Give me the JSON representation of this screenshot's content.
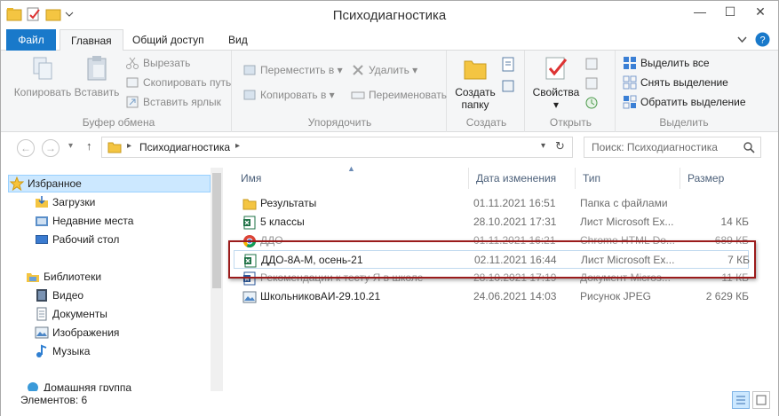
{
  "window": {
    "title": "Психодиагностика"
  },
  "tabs": [
    {
      "label": "Файл"
    },
    {
      "label": "Главная"
    },
    {
      "label": "Общий доступ"
    },
    {
      "label": "Вид"
    }
  ],
  "ribbon": {
    "clipboard": {
      "label": "Буфер обмена",
      "copy": "Копировать",
      "paste": "Вставить",
      "cut": "Вырезать",
      "copy_path": "Скопировать путь",
      "paste_shortcut": "Вставить ярлык"
    },
    "organize": {
      "label": "Упорядочить",
      "move_to": "Переместить в",
      "copy_to": "Копировать в",
      "delete": "Удалить",
      "rename": "Переименовать"
    },
    "create": {
      "label": "Создать",
      "new_folder_line1": "Создать",
      "new_folder_line2": "папку"
    },
    "open": {
      "label": "Открыть",
      "properties": "Свойства"
    },
    "select": {
      "label": "Выделить",
      "select_all": "Выделить все",
      "select_none": "Снять выделение",
      "invert": "Обратить выделение"
    }
  },
  "address": {
    "path": "Психодиагностика",
    "search_placeholder": "Поиск: Психодиагностика"
  },
  "nav": {
    "favorites": "Избранное",
    "downloads": "Загрузки",
    "recent": "Недавние места",
    "desktop": "Рабочий стол",
    "libraries": "Библиотеки",
    "video": "Видео",
    "documents": "Документы",
    "images": "Изображения",
    "music": "Музыка",
    "homegroup": "Домашняя группа"
  },
  "columns": {
    "name": "Имя",
    "date": "Дата изменения",
    "type": "Тип",
    "size": "Размер"
  },
  "files": [
    {
      "name": "Результаты",
      "date": "01.11.2021 16:51",
      "type": "Папка с файлами",
      "size": "",
      "icon": "folder-icon"
    },
    {
      "name": "5 классы",
      "date": "28.10.2021 17:31",
      "type": "Лист Microsoft Ex...",
      "size": "14 КБ",
      "icon": "excel-icon"
    },
    {
      "name": "ДДО",
      "date": "01.11.2021 16:21",
      "type": "Chrome HTML Do...",
      "size": "689 КБ",
      "icon": "chrome-icon"
    },
    {
      "name": "ДДО-8А-М, осень-21",
      "date": "02.11.2021 16:44",
      "type": "Лист Microsoft Ex...",
      "size": "7 КБ",
      "icon": "excel-icon"
    },
    {
      "name": "Рекомендации к тесту Я в школе",
      "date": "28.10.2021 17:19",
      "type": "Документ Micros...",
      "size": "11 КБ",
      "icon": "word-icon"
    },
    {
      "name": "ШкольниковАИ-29.10.21",
      "date": "24.06.2021 14:03",
      "type": "Рисунок JPEG",
      "size": "2 629 КБ",
      "icon": "image-icon"
    }
  ],
  "status": {
    "items_count": "Элементов: 6"
  },
  "colors": {
    "file_tab": "#1979ca",
    "selection": "#cce8ff",
    "highlight_border": "#9b1b1b"
  }
}
